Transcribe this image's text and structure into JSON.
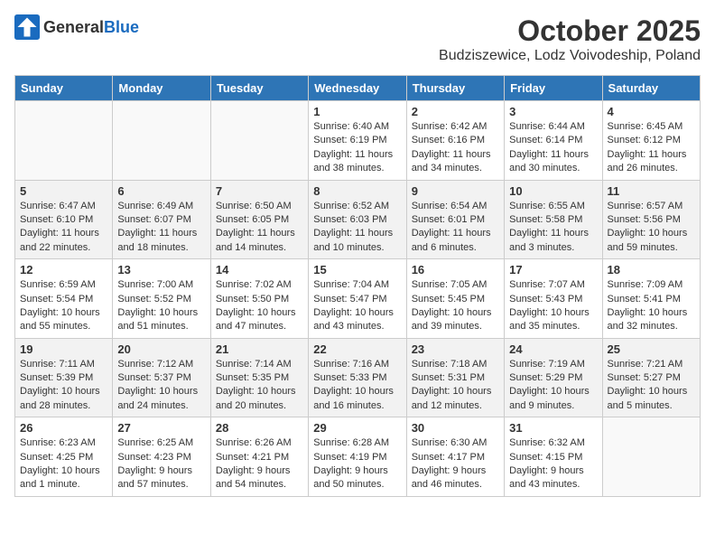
{
  "logo": {
    "general": "General",
    "blue": "Blue"
  },
  "title": "October 2025",
  "location": "Budziszewice, Lodz Voivodeship, Poland",
  "days_of_week": [
    "Sunday",
    "Monday",
    "Tuesday",
    "Wednesday",
    "Thursday",
    "Friday",
    "Saturday"
  ],
  "weeks": [
    [
      {
        "day": "",
        "content": ""
      },
      {
        "day": "",
        "content": ""
      },
      {
        "day": "",
        "content": ""
      },
      {
        "day": "1",
        "content": "Sunrise: 6:40 AM\nSunset: 6:19 PM\nDaylight: 11 hours and 38 minutes."
      },
      {
        "day": "2",
        "content": "Sunrise: 6:42 AM\nSunset: 6:16 PM\nDaylight: 11 hours and 34 minutes."
      },
      {
        "day": "3",
        "content": "Sunrise: 6:44 AM\nSunset: 6:14 PM\nDaylight: 11 hours and 30 minutes."
      },
      {
        "day": "4",
        "content": "Sunrise: 6:45 AM\nSunset: 6:12 PM\nDaylight: 11 hours and 26 minutes."
      }
    ],
    [
      {
        "day": "5",
        "content": "Sunrise: 6:47 AM\nSunset: 6:10 PM\nDaylight: 11 hours and 22 minutes."
      },
      {
        "day": "6",
        "content": "Sunrise: 6:49 AM\nSunset: 6:07 PM\nDaylight: 11 hours and 18 minutes."
      },
      {
        "day": "7",
        "content": "Sunrise: 6:50 AM\nSunset: 6:05 PM\nDaylight: 11 hours and 14 minutes."
      },
      {
        "day": "8",
        "content": "Sunrise: 6:52 AM\nSunset: 6:03 PM\nDaylight: 11 hours and 10 minutes."
      },
      {
        "day": "9",
        "content": "Sunrise: 6:54 AM\nSunset: 6:01 PM\nDaylight: 11 hours and 6 minutes."
      },
      {
        "day": "10",
        "content": "Sunrise: 6:55 AM\nSunset: 5:58 PM\nDaylight: 11 hours and 3 minutes."
      },
      {
        "day": "11",
        "content": "Sunrise: 6:57 AM\nSunset: 5:56 PM\nDaylight: 10 hours and 59 minutes."
      }
    ],
    [
      {
        "day": "12",
        "content": "Sunrise: 6:59 AM\nSunset: 5:54 PM\nDaylight: 10 hours and 55 minutes."
      },
      {
        "day": "13",
        "content": "Sunrise: 7:00 AM\nSunset: 5:52 PM\nDaylight: 10 hours and 51 minutes."
      },
      {
        "day": "14",
        "content": "Sunrise: 7:02 AM\nSunset: 5:50 PM\nDaylight: 10 hours and 47 minutes."
      },
      {
        "day": "15",
        "content": "Sunrise: 7:04 AM\nSunset: 5:47 PM\nDaylight: 10 hours and 43 minutes."
      },
      {
        "day": "16",
        "content": "Sunrise: 7:05 AM\nSunset: 5:45 PM\nDaylight: 10 hours and 39 minutes."
      },
      {
        "day": "17",
        "content": "Sunrise: 7:07 AM\nSunset: 5:43 PM\nDaylight: 10 hours and 35 minutes."
      },
      {
        "day": "18",
        "content": "Sunrise: 7:09 AM\nSunset: 5:41 PM\nDaylight: 10 hours and 32 minutes."
      }
    ],
    [
      {
        "day": "19",
        "content": "Sunrise: 7:11 AM\nSunset: 5:39 PM\nDaylight: 10 hours and 28 minutes."
      },
      {
        "day": "20",
        "content": "Sunrise: 7:12 AM\nSunset: 5:37 PM\nDaylight: 10 hours and 24 minutes."
      },
      {
        "day": "21",
        "content": "Sunrise: 7:14 AM\nSunset: 5:35 PM\nDaylight: 10 hours and 20 minutes."
      },
      {
        "day": "22",
        "content": "Sunrise: 7:16 AM\nSunset: 5:33 PM\nDaylight: 10 hours and 16 minutes."
      },
      {
        "day": "23",
        "content": "Sunrise: 7:18 AM\nSunset: 5:31 PM\nDaylight: 10 hours and 12 minutes."
      },
      {
        "day": "24",
        "content": "Sunrise: 7:19 AM\nSunset: 5:29 PM\nDaylight: 10 hours and 9 minutes."
      },
      {
        "day": "25",
        "content": "Sunrise: 7:21 AM\nSunset: 5:27 PM\nDaylight: 10 hours and 5 minutes."
      }
    ],
    [
      {
        "day": "26",
        "content": "Sunrise: 6:23 AM\nSunset: 4:25 PM\nDaylight: 10 hours and 1 minute."
      },
      {
        "day": "27",
        "content": "Sunrise: 6:25 AM\nSunset: 4:23 PM\nDaylight: 9 hours and 57 minutes."
      },
      {
        "day": "28",
        "content": "Sunrise: 6:26 AM\nSunset: 4:21 PM\nDaylight: 9 hours and 54 minutes."
      },
      {
        "day": "29",
        "content": "Sunrise: 6:28 AM\nSunset: 4:19 PM\nDaylight: 9 hours and 50 minutes."
      },
      {
        "day": "30",
        "content": "Sunrise: 6:30 AM\nSunset: 4:17 PM\nDaylight: 9 hours and 46 minutes."
      },
      {
        "day": "31",
        "content": "Sunrise: 6:32 AM\nSunset: 4:15 PM\nDaylight: 9 hours and 43 minutes."
      },
      {
        "day": "",
        "content": ""
      }
    ]
  ]
}
